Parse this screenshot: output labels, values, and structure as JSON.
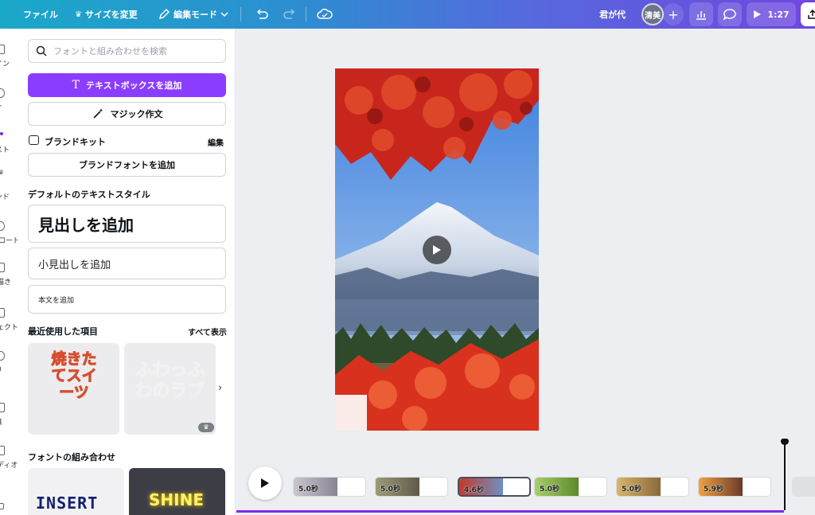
{
  "topbar": {
    "file_label": "ファイル",
    "resize_label": "サイズを変更",
    "edit_mode_label": "編集モード",
    "team_name": "君が代",
    "avatar_initials": "清美",
    "duration": "1:27"
  },
  "rail": {
    "items": [
      {
        "label": "イン",
        "icon": "design-icon"
      },
      {
        "label": "オ",
        "icon": "elements-icon"
      },
      {
        "label": "スト",
        "icon": "text-icon"
      },
      {
        "label": "ンド",
        "icon": "brand-icon"
      },
      {
        "label": "ロード",
        "icon": "upload-icon"
      },
      {
        "label": "描き",
        "icon": "draw-icon"
      },
      {
        "label": "ェクト",
        "icon": "projects-icon"
      },
      {
        "label": "リ",
        "icon": "apps-icon"
      },
      {
        "label": "真",
        "icon": "photos-icon"
      },
      {
        "label": "ディオ",
        "icon": "audio-icon"
      }
    ]
  },
  "panel": {
    "search_placeholder": "フォントと組み合わせを検索",
    "add_textbox": "テキストボックスを追加",
    "magic_write": "マジック作文",
    "brand_kit_label": "ブランドキット",
    "brand_kit_edit": "編集",
    "add_brand_font": "ブランドフォントを追加",
    "default_styles_label": "デフォルトのテキストスタイル",
    "add_heading": "見出しを追加",
    "add_subheading": "小見出しを追加",
    "add_body": "本文を追加",
    "recent_label": "最近使用した項目",
    "show_all": "すべて表示",
    "recent_items": [
      {
        "text": "焼きたてスイーツ"
      },
      {
        "text": "ふわっふわのラブ"
      }
    ],
    "font_combos_label": "フォントの組み合わせ",
    "font_combos": [
      {
        "text": "INSERT"
      },
      {
        "text": "SHINE"
      }
    ]
  },
  "timeline": {
    "clips": [
      {
        "duration": "5.0秒",
        "colors": [
          "#c9c6cf",
          "#8a8592"
        ]
      },
      {
        "duration": "5.0秒",
        "colors": [
          "#9c9a78",
          "#5f5a4a"
        ]
      },
      {
        "duration": "4.6秒",
        "colors": [
          "#c43a2a",
          "#6e8fc6"
        ],
        "selected": true
      },
      {
        "duration": "5.0秒",
        "colors": [
          "#a7cf6a",
          "#5c8a2c"
        ]
      },
      {
        "duration": "5.0秒",
        "colors": [
          "#d9b46a",
          "#8a6a3a"
        ]
      },
      {
        "duration": "5.9秒",
        "colors": [
          "#f0a040",
          "#6a3a2a"
        ]
      }
    ]
  },
  "colors": {
    "accent": "#8b3dff",
    "progress": "#7d2ae8"
  }
}
